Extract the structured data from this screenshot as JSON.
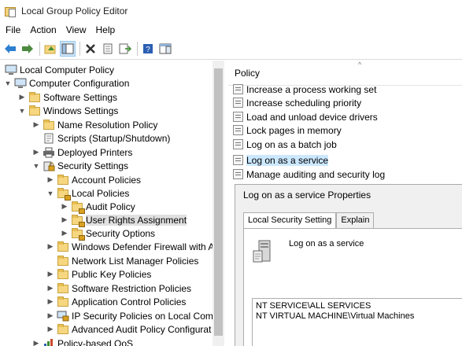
{
  "window": {
    "title": "Local Group Policy Editor"
  },
  "menu": [
    "File",
    "Action",
    "View",
    "Help"
  ],
  "toolbar": {
    "icons": [
      "back-arrow-icon",
      "forward-arrow-icon",
      "up-folder-icon",
      "show-hide-tree-icon",
      "delete-icon",
      "properties-icon",
      "export-list-icon",
      "help-icon",
      "show-pane-icon"
    ]
  },
  "tree": [
    {
      "label": "Local Computer Policy",
      "icon": "computer-icon",
      "arrow": ""
    },
    {
      "label": "Computer Configuration",
      "icon": "computer-icon",
      "arrow": "down"
    },
    {
      "label": "Software Settings",
      "icon": "folder-icon",
      "arrow": "right"
    },
    {
      "label": "Windows Settings",
      "icon": "folder-icon",
      "arrow": "down"
    },
    {
      "label": "Name Resolution Policy",
      "icon": "folder-icon",
      "arrow": "right"
    },
    {
      "label": "Scripts (Startup/Shutdown)",
      "icon": "scripts-icon",
      "arrow": ""
    },
    {
      "label": "Deployed Printers",
      "icon": "printer-icon",
      "arrow": "right"
    },
    {
      "label": "Security Settings",
      "icon": "security-icon",
      "arrow": "down"
    },
    {
      "label": "Account Policies",
      "icon": "folder-icon",
      "arrow": "right"
    },
    {
      "label": "Local Policies",
      "icon": "folder-lock-icon",
      "arrow": "down"
    },
    {
      "label": "Audit Policy",
      "icon": "folder-lock-icon",
      "arrow": "right"
    },
    {
      "label": "User Rights Assignment",
      "icon": "folder-lock-icon",
      "arrow": "right",
      "selected": true
    },
    {
      "label": "Security Options",
      "icon": "folder-lock-icon",
      "arrow": "right"
    },
    {
      "label": "Windows Defender Firewall with A",
      "icon": "folder-icon",
      "arrow": "right"
    },
    {
      "label": "Network List Manager Policies",
      "icon": "folder-icon",
      "arrow": ""
    },
    {
      "label": "Public Key Policies",
      "icon": "folder-icon",
      "arrow": "right"
    },
    {
      "label": "Software Restriction Policies",
      "icon": "folder-icon",
      "arrow": "right"
    },
    {
      "label": "Application Control Policies",
      "icon": "folder-icon",
      "arrow": "right"
    },
    {
      "label": "IP Security Policies on Local Comp",
      "icon": "ip-security-icon",
      "arrow": "right"
    },
    {
      "label": "Advanced Audit Policy Configurat",
      "icon": "folder-icon",
      "arrow": "right"
    },
    {
      "label": "Policy-based QoS",
      "icon": "qos-chart-icon",
      "arrow": "right"
    }
  ],
  "right": {
    "header": "Policy",
    "policies": [
      {
        "label": "Increase a process working set"
      },
      {
        "label": "Increase scheduling priority"
      },
      {
        "label": "Load and unload device drivers"
      },
      {
        "label": "Lock pages in memory"
      },
      {
        "label": "Log on as a batch job"
      },
      {
        "label": "Log on as a service",
        "selected": true
      },
      {
        "label": "Manage auditing and security log"
      }
    ]
  },
  "props": {
    "title": "Log on as a service Properties",
    "tabs": [
      {
        "label": "Local Security Setting",
        "active": true
      },
      {
        "label": "Explain"
      }
    ],
    "service_name": "Log on as a service",
    "accounts": [
      "NT SERVICE\\ALL SERVICES",
      "NT VIRTUAL MACHINE\\Virtual Machines"
    ]
  }
}
